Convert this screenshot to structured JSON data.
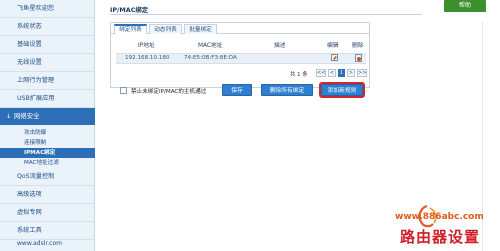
{
  "sidebar": {
    "items": [
      {
        "label": "飞鱼星欢迎您"
      },
      {
        "label": "系统状态"
      },
      {
        "label": "基础设置"
      },
      {
        "label": "无线设置"
      },
      {
        "label": "上网行为管理"
      },
      {
        "label": "USB扩展应用"
      }
    ],
    "section": {
      "label": "网络安全"
    },
    "sub_items": [
      {
        "label": "攻击防御"
      },
      {
        "label": "连接限制"
      },
      {
        "label": "IPMAC绑定"
      },
      {
        "label": "MAC地址过滤"
      }
    ],
    "items_after": [
      {
        "label": "QoS流量控制"
      },
      {
        "label": "高级选项"
      },
      {
        "label": "虚拟专网"
      },
      {
        "label": "系统工具"
      }
    ],
    "footer": "www.adslr.com"
  },
  "header": {
    "title": "IP/MAC绑定",
    "help_label": "帮助"
  },
  "tabs": [
    {
      "label": "绑定列表"
    },
    {
      "label": "动态列表"
    },
    {
      "label": "批量绑定"
    }
  ],
  "table": {
    "columns": [
      "IP地址",
      "MAC地址",
      "描述",
      "编辑",
      "删除"
    ],
    "rows": [
      {
        "ip": "192.168.10.180",
        "mac": "74:E5:0B:F3:8E:DA",
        "desc": ""
      }
    ]
  },
  "pager": {
    "total_label": "共 1 条",
    "first": "<<",
    "prev": "<",
    "page": "1",
    "next": ">",
    "last": ">>"
  },
  "controls": {
    "checkbox_label": "禁止未绑定IP/MAC的主机通过",
    "save_label": "保存",
    "delete_all_label": "删除所有绑定",
    "add_rule_label": "添加新规则"
  },
  "watermark": {
    "url": "www.886abc.com",
    "title": "路由器设置"
  }
}
